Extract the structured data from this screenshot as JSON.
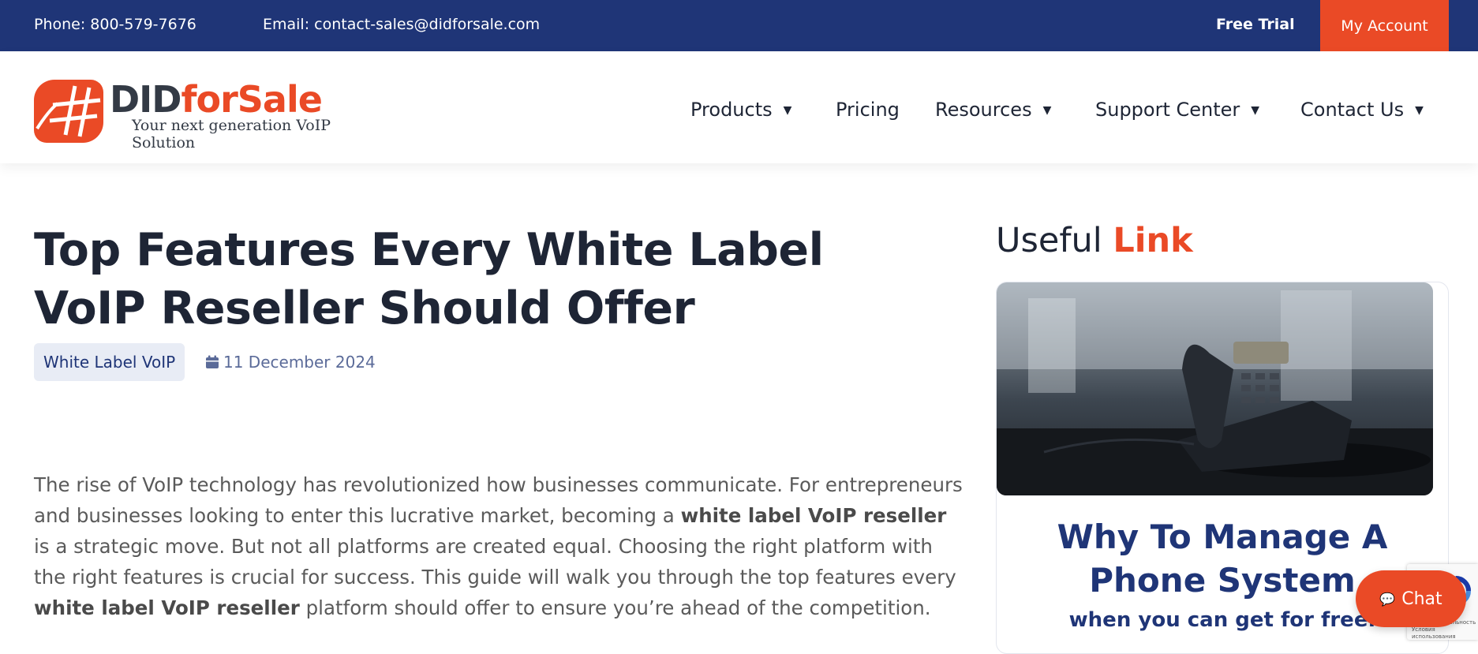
{
  "topbar": {
    "phone": "Phone: 800-579-7676",
    "email": "Email: contact-sales@didforsale.com",
    "free_trial": "Free Trial",
    "my_account": "My Account"
  },
  "logo": {
    "name_part1": "DID",
    "name_part2": "forSale",
    "tagline": "Your next generation VoIP Solution"
  },
  "nav": {
    "items": [
      {
        "label": "Products",
        "dropdown": true
      },
      {
        "label": "Pricing",
        "dropdown": false
      },
      {
        "label": "Resources",
        "dropdown": true
      },
      {
        "label": "Support Center",
        "dropdown": true
      },
      {
        "label": "Contact Us",
        "dropdown": true
      }
    ],
    "caret": "▼"
  },
  "article": {
    "title": "Top Features Every White Label VoIP Reseller Should Offer",
    "category": "White Label VoIP",
    "date": "11 December 2024",
    "intro": {
      "p1": "The rise of VoIP technology has revolutionized how businesses communicate. For entrepreneurs and businesses looking to enter this lucrative market, becoming a ",
      "b1": "white label VoIP reseller",
      "p2": " is a strategic move. But not all platforms are created equal. Choosing the right platform with the right features is crucial for success. This guide will walk you through the top features every ",
      "b2": "white label VoIP reseller",
      "p3": " platform should offer to ensure you’re ahead of the competition."
    }
  },
  "sidebar": {
    "heading_plain": "Useful ",
    "heading_highlight": "Link",
    "card": {
      "heading": "Why To Manage A Phone System",
      "subheading": "when you can get for free."
    }
  },
  "chat": {
    "label": "Chat",
    "icon": "chat-bubble-icon"
  },
  "recaptcha": {
    "line1": "Конфиденциальность",
    "line2": "Условия использования"
  },
  "colors": {
    "brand_navy": "#1f3577",
    "brand_orange": "#ea4a26",
    "text_dark": "#1e2535"
  }
}
